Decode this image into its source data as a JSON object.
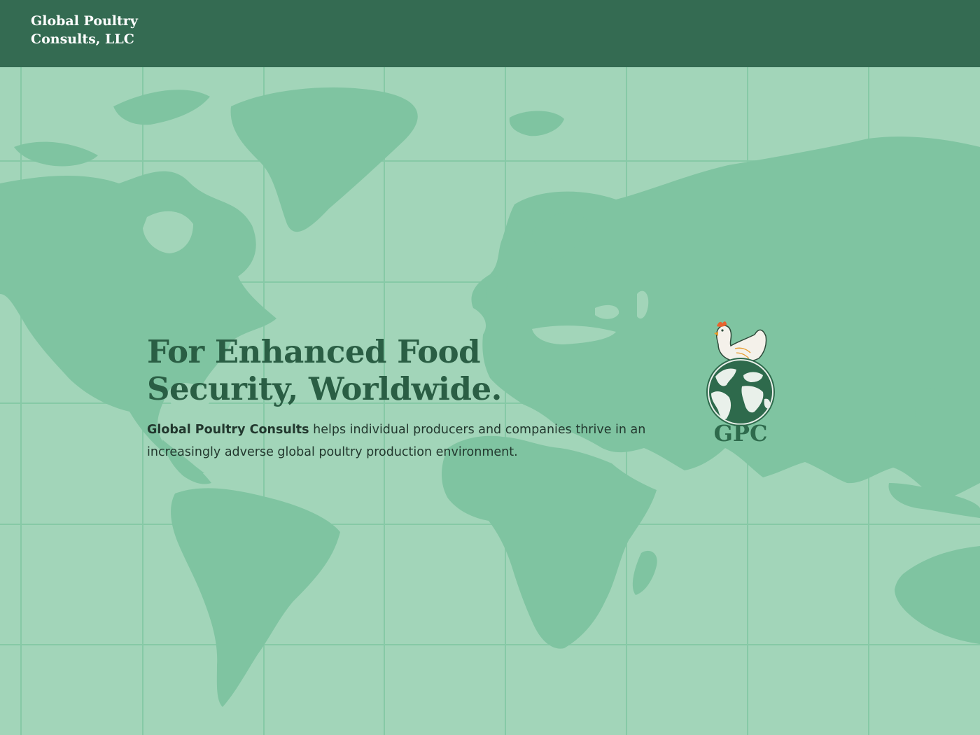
{
  "header": {
    "brand_line1": "Global Poultry",
    "brand_line2": "Consults, LLC"
  },
  "hero": {
    "title_line1": "For Enhanced Food",
    "title_line2": "Security, Worldwide.",
    "body_strong": "Global Poultry Consults",
    "body_rest": " helps individual producers and companies thrive in an increasingly adverse global poultry production environment."
  },
  "logo": {
    "text": "GPC",
    "icon": "chicken-on-globe-icon"
  },
  "colors": {
    "header_bg": "#346b52",
    "page_bg": "#a2d5b9",
    "land": "#7fc4a1",
    "grid": "#86c9a6",
    "title": "#2a5e44",
    "logo_green": "#2e6a4c"
  }
}
